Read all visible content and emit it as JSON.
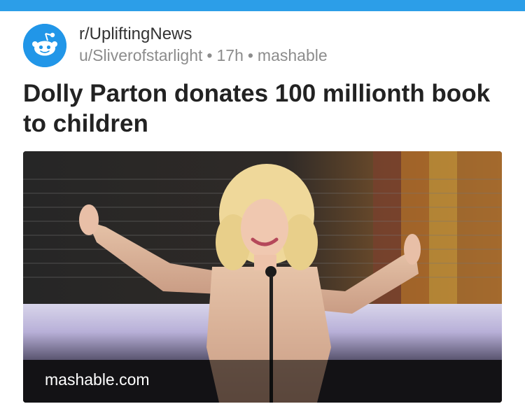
{
  "post": {
    "subreddit": "r/UpliftingNews",
    "author": "u/Sliverofstarlight",
    "age": "17h",
    "source": "mashable",
    "separator": "•",
    "title": "Dolly Parton donates 100 millionth book to children",
    "thumbnail_domain": "mashable.com"
  },
  "colors": {
    "topbar": "#2c9ee8",
    "avatar": "#2196e8",
    "title": "#222222",
    "meta": "#8c8c8c"
  },
  "icons": {
    "avatar": "reddit-snoo-icon"
  }
}
